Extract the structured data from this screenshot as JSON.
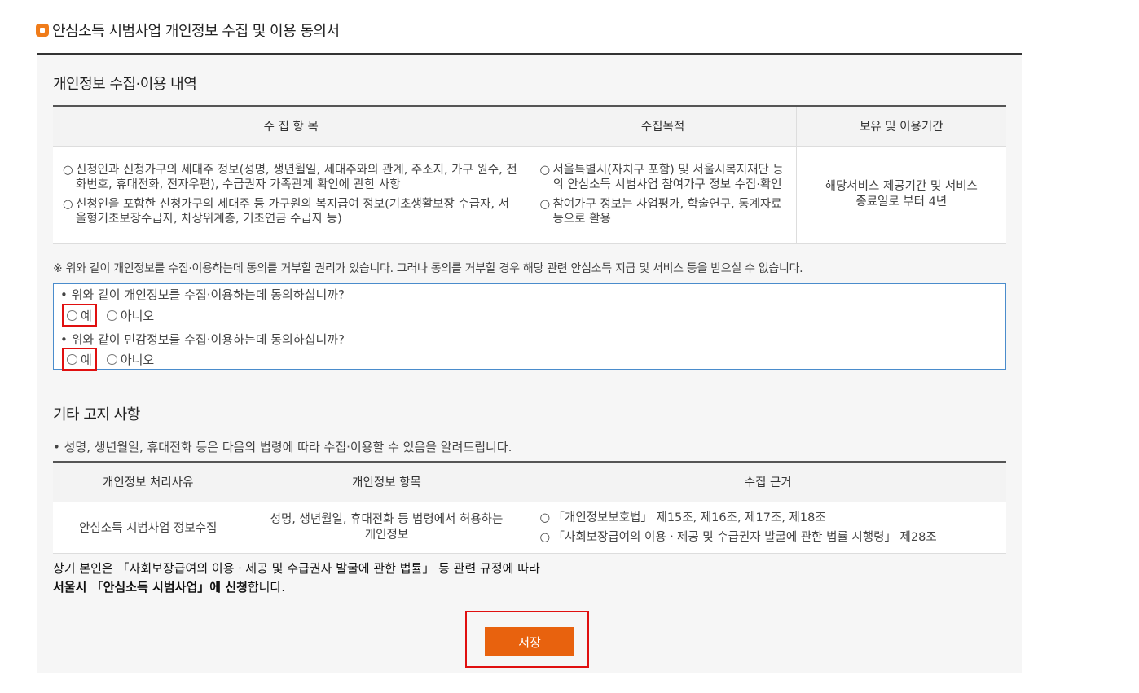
{
  "page": {
    "title": "안심소득 시범사업 개인정보 수집 및 이용 동의서"
  },
  "section1": {
    "heading": "개인정보 수집·이용 내역",
    "headers": [
      "수 집 항 목",
      "수집목적",
      "보유 및 이용기간"
    ],
    "items": [
      "신청인과 신청가구의 세대주 정보(성명, 생년월일, 세대주와의 관계, 주소지, 가구 원수, 전화번호, 휴대전화, 전자우편), 수급권자 가족관계 확인에 관한 사항",
      "신청인을 포함한 신청가구의 세대주 등 가구원의 복지급여 정보(기초생활보장 수급자, 서울형기초보장수급자, 차상위계층, 기초연금 수급자 등)"
    ],
    "purposes": [
      "서울특별시(자치구 포함) 및 서울시복지재단 등의 안심소득 시범사업 참여가구 정보 수집·확인",
      "참여가구 정보는 사업평가, 학술연구, 통계자료 등으로 활용"
    ],
    "period": "해당서비스 제공기간 및 서비스 종료일로 부터 4년",
    "circle": "○",
    "notice": "※ 위와 같이 개인정보를 수집·이용하는데 동의를 거부할 권리가 있습니다. 그러나 동의를 거부할 경우 해당 관련 안심소득 지급 및 서비스 등을 받으실 수 없습니다."
  },
  "consent": {
    "q1": "• 위와 같이 개인정보를 수집·이용하는데 동의하십니까?",
    "q2": "• 위와 같이 민감정보를 수집·이용하는데 동의하십니까?",
    "yes": "예",
    "no": "아니오"
  },
  "section2": {
    "heading": "기타 고지 사항",
    "intro": "• 성명, 생년월일, 휴대전화 등은 다음의 법령에 따라 수집·이용할 수 있음을 알려드립니다.",
    "headers": [
      "개인정보 처리사유",
      "개인정보 항목",
      "수집 근거"
    ],
    "reason": "안심소득 시범사업 정보수집",
    "items": "성명, 생년월일, 휴대전화 등 법령에서 허용하는 개인정보",
    "basis": [
      "「개인정보보호법」 제15조, 제16조, 제17조, 제18조",
      "「사회보장급여의 이용ㆍ제공 및 수급권자 발굴에 관한 법률 시행령」 제28조"
    ]
  },
  "declaration": {
    "line1": "상기 본인은 「사회보장급여의 이용ㆍ제공 및 수급권자 발굴에 관한 법률」 등 관련 규정에 따라",
    "line2_bold": "서울시 「안심소득 시범사업」에 신청",
    "line2_rest": "합니다."
  },
  "save_label": "저장"
}
